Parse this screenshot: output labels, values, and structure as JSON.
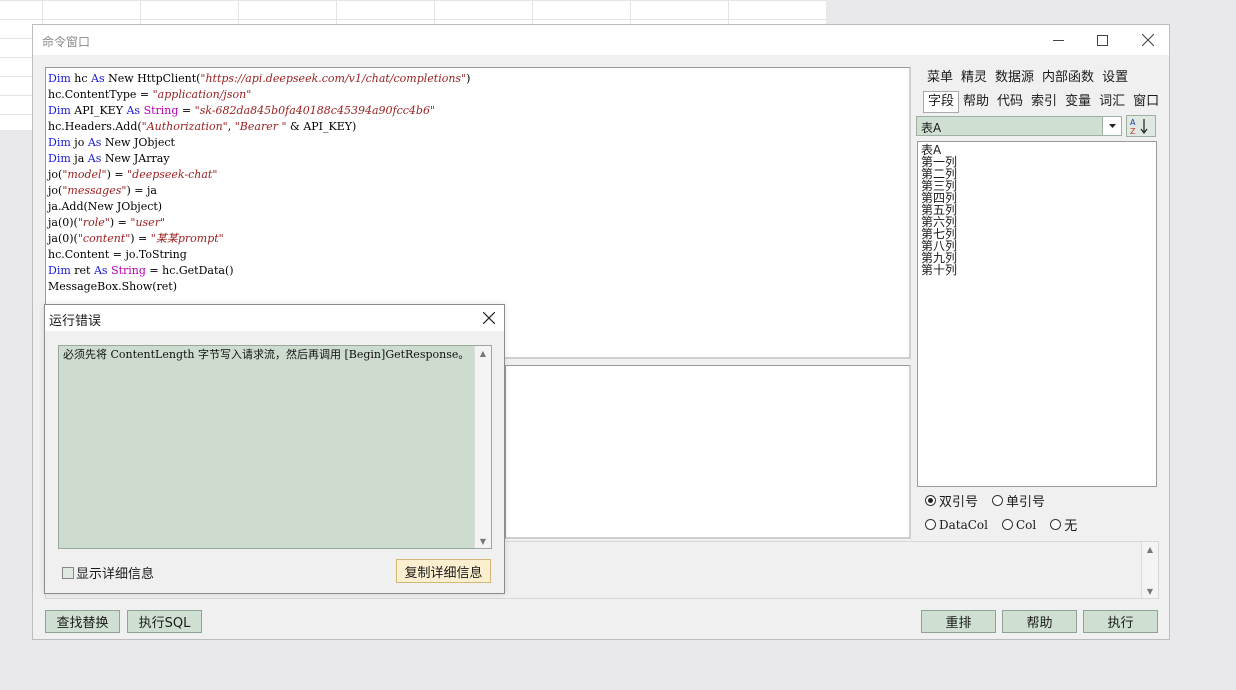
{
  "window": {
    "title": "命令窗口"
  },
  "editor": {
    "lines": [
      [
        {
          "t": "Dim",
          "c": "kw"
        },
        {
          "t": " hc "
        },
        {
          "t": "As",
          "c": "kw"
        },
        {
          "t": " New HttpClient("
        },
        {
          "t": "\"https://api.deepseek.com/v1/chat/completions\"",
          "c": "str"
        },
        {
          "t": ")"
        }
      ],
      [
        {
          "t": "hc.ContentType = "
        },
        {
          "t": "\"application/json\"",
          "c": "str"
        }
      ],
      [
        {
          "t": "Dim",
          "c": "kw"
        },
        {
          "t": " API_KEY "
        },
        {
          "t": "As",
          "c": "kw"
        },
        {
          "t": " "
        },
        {
          "t": "String",
          "c": "ty"
        },
        {
          "t": " = "
        },
        {
          "t": "\"sk-682da845b0fa40188c45394a90fcc4b6\"",
          "c": "str"
        }
      ],
      [
        {
          "t": "hc.Headers.Add("
        },
        {
          "t": "\"Authorization\"",
          "c": "str"
        },
        {
          "t": ", "
        },
        {
          "t": "\"Bearer \"",
          "c": "str"
        },
        {
          "t": " & API_KEY)"
        }
      ],
      [
        {
          "t": "Dim",
          "c": "kw"
        },
        {
          "t": " jo "
        },
        {
          "t": "As",
          "c": "kw"
        },
        {
          "t": " New JObject"
        }
      ],
      [
        {
          "t": "Dim",
          "c": "kw"
        },
        {
          "t": " ja "
        },
        {
          "t": "As",
          "c": "kw"
        },
        {
          "t": " New JArray"
        }
      ],
      [
        {
          "t": "jo("
        },
        {
          "t": "\"model\"",
          "c": "str"
        },
        {
          "t": ") = "
        },
        {
          "t": "\"deepseek-chat\"",
          "c": "str"
        }
      ],
      [
        {
          "t": "jo("
        },
        {
          "t": "\"messages\"",
          "c": "str"
        },
        {
          "t": ") = ja"
        }
      ],
      [
        {
          "t": "ja.Add(New JObject)"
        }
      ],
      [
        {
          "t": "ja(0)("
        },
        {
          "t": "\"role\"",
          "c": "str"
        },
        {
          "t": ") = "
        },
        {
          "t": "\"user\"",
          "c": "str"
        }
      ],
      [
        {
          "t": "ja(0)("
        },
        {
          "t": "\"content\"",
          "c": "str"
        },
        {
          "t": ") = "
        },
        {
          "t": "\"某某prompt\"",
          "c": "str"
        }
      ],
      [
        {
          "t": "hc.Content = jo.ToString"
        }
      ],
      [
        {
          "t": "Dim",
          "c": "kw"
        },
        {
          "t": " ret "
        },
        {
          "t": "As",
          "c": "kw"
        },
        {
          "t": " "
        },
        {
          "t": "String",
          "c": "ty"
        },
        {
          "t": " = hc.GetData()"
        }
      ],
      [
        {
          "t": "MessageBox.Show(ret)"
        }
      ]
    ]
  },
  "side_panel": {
    "menu_row1": [
      "菜单",
      "精灵",
      "数据源",
      "内部函数",
      "设置"
    ],
    "menu_row2": [
      "字段",
      "帮助",
      "代码",
      "索引",
      "变量",
      "词汇",
      "窗口"
    ],
    "active_tab": "字段",
    "table_select": "表A",
    "fields": [
      "表A",
      "第一列",
      "第二列",
      "第三列",
      "第四列",
      "第五列",
      "第六列",
      "第七列",
      "第八列",
      "第九列",
      "第十列"
    ],
    "quote_options": [
      {
        "label": "双引号",
        "checked": true
      },
      {
        "label": "单引号",
        "checked": false
      }
    ],
    "col_options": [
      {
        "label": "DataCol",
        "checked": false
      },
      {
        "label": "Col",
        "checked": false
      },
      {
        "label": "无",
        "checked": false
      }
    ]
  },
  "buttons": {
    "find_replace": "查找替换",
    "exec_sql": "执行SQL",
    "reset": "重排",
    "help": "帮助",
    "execute": "执行"
  },
  "error_dialog": {
    "title": "运行错误",
    "message": "必须先将 ContentLength 字节写入请求流，然后再调用 [Begin]GetResponse。",
    "show_details_label": "显示详细信息",
    "show_details_checked": false,
    "copy_details_label": "复制详细信息"
  }
}
